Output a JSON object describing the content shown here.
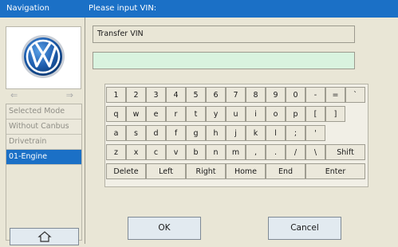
{
  "titlebar": {
    "left": "Navigation",
    "right": "Please input VIN:"
  },
  "sidebar": {
    "logo": "vw-logo",
    "items": [
      "Selected Mode",
      "Without Canbus",
      "Drivetrain",
      "01-Engine"
    ],
    "active_index": 3
  },
  "fields": {
    "vin_label": "Transfer VIN",
    "vin_value": ""
  },
  "keyboard": {
    "row1": [
      "1",
      "2",
      "3",
      "4",
      "5",
      "6",
      "7",
      "8",
      "9",
      "0",
      "-",
      "=",
      "`"
    ],
    "row2": [
      "q",
      "w",
      "e",
      "r",
      "t",
      "y",
      "u",
      "i",
      "o",
      "p",
      "[",
      "]"
    ],
    "row3": [
      "a",
      "s",
      "d",
      "f",
      "g",
      "h",
      "j",
      "k",
      "l",
      ";",
      "'"
    ],
    "row4": [
      "z",
      "x",
      "c",
      "v",
      "b",
      "n",
      "m",
      ",",
      ".",
      "/",
      "\\",
      "Shift"
    ],
    "row5": [
      "Delete",
      "Left",
      "Right",
      "Home",
      "End",
      "Enter"
    ]
  },
  "buttons": {
    "ok": "OK",
    "cancel": "Cancel"
  },
  "colors": {
    "titlebar": "#1b70c6",
    "active_item": "#1b70c6",
    "vin_input_bg": "#d9f3df"
  }
}
